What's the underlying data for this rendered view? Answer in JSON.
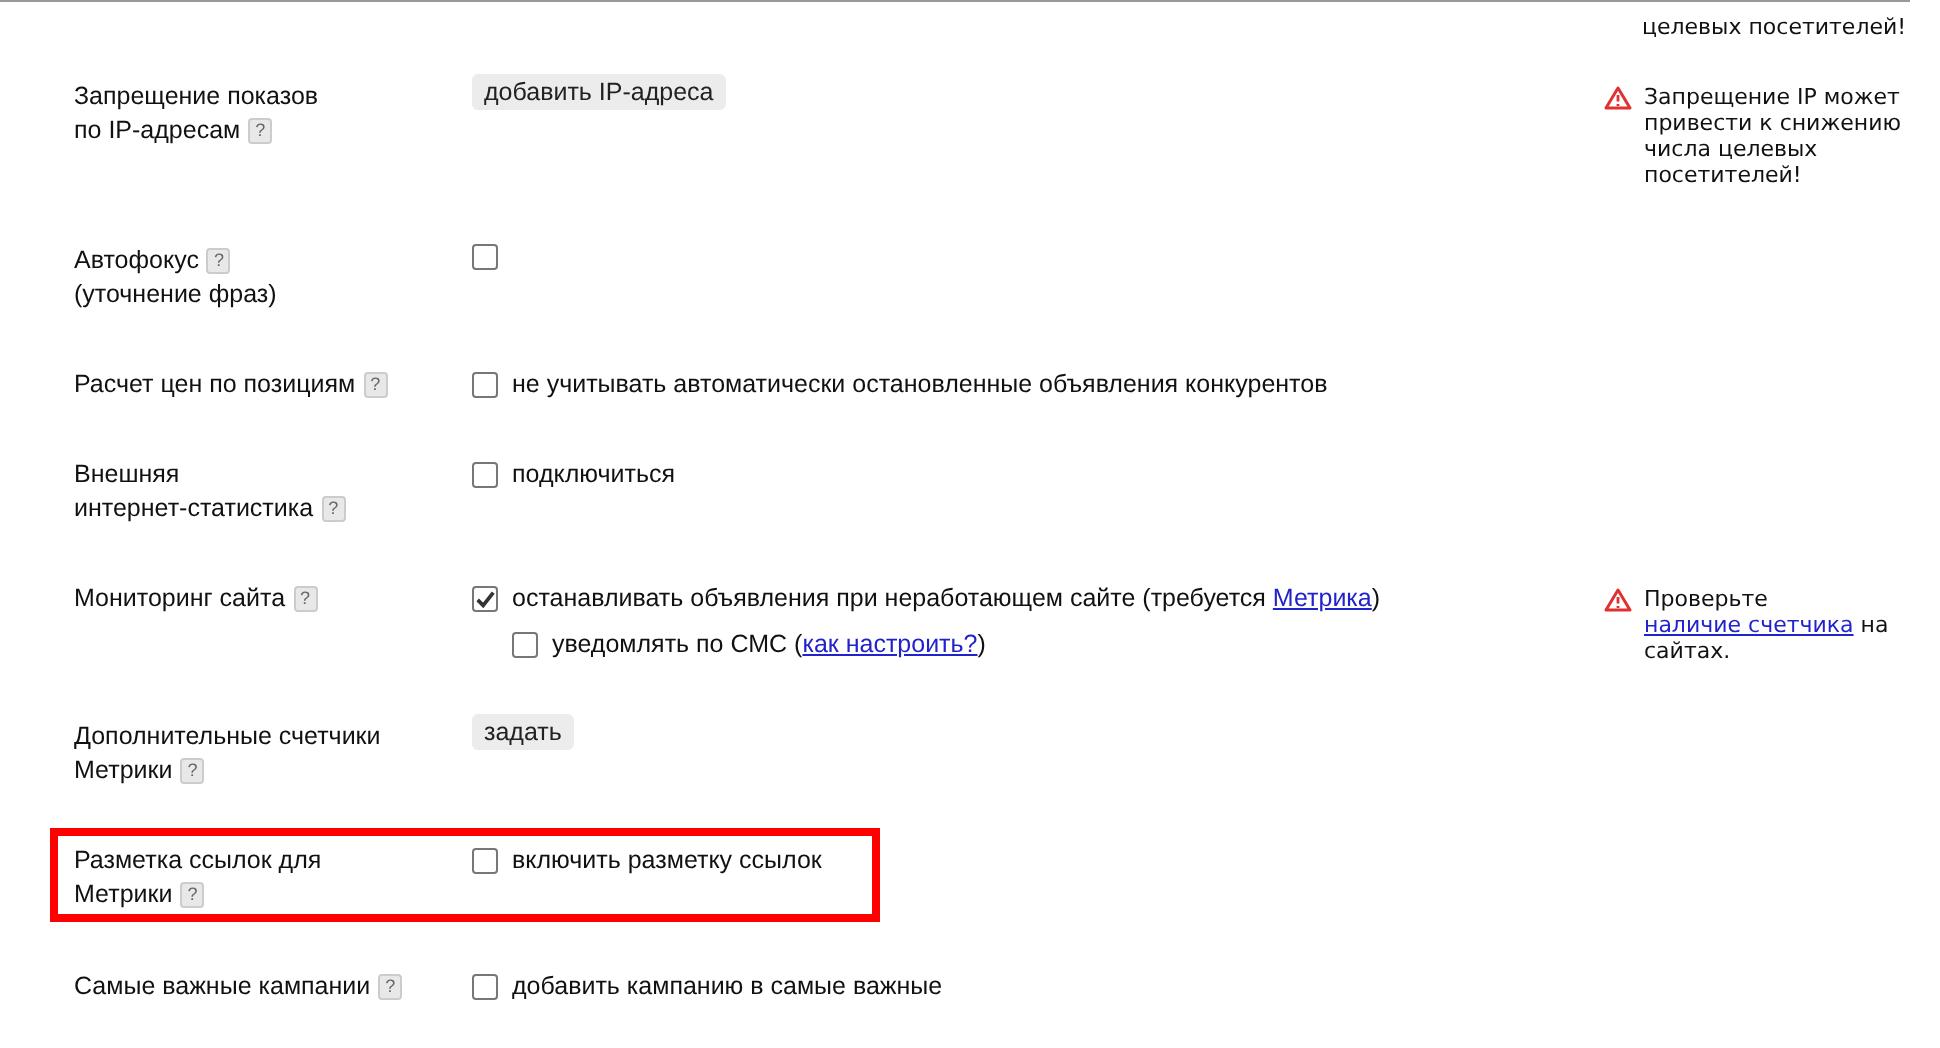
{
  "previous_note": {
    "parts": [
      {
        "text": "целевых посетителей!"
      }
    ]
  },
  "rows": [
    {
      "label_lines": [
        {
          "text": "Запрещение показов"
        },
        {
          "text": "по IP-адресам",
          "help": "?"
        }
      ],
      "highlighted": false,
      "controls": [
        {
          "kind": "button",
          "label": "добавить IP-адреса"
        }
      ],
      "note": {
        "parts": [
          {
            "text": "Запрещение IP может привести к снижению числа целевых посетителей!"
          }
        ]
      }
    },
    {
      "label_lines": [
        {
          "text": "Автофокус",
          "help": "?"
        },
        {
          "text": "(уточнение фраз)"
        }
      ],
      "highlighted": false,
      "controls": [
        {
          "kind": "checkbox",
          "checked": false
        }
      ]
    },
    {
      "label_lines": [
        {
          "text": "Расчет цен по позициям",
          "help": "?"
        }
      ],
      "highlighted": false,
      "controls": [
        {
          "kind": "checkbox",
          "checked": false,
          "parts": [
            {
              "text": "не учитывать автоматически остановленные объявления конкурентов"
            }
          ]
        }
      ]
    },
    {
      "label_lines": [
        {
          "text": "Внешняя"
        },
        {
          "text": "интернет-статистика",
          "help": "?"
        }
      ],
      "highlighted": false,
      "controls": [
        {
          "kind": "checkbox",
          "checked": false,
          "parts": [
            {
              "text": "подключиться"
            }
          ]
        }
      ]
    },
    {
      "label_lines": [
        {
          "text": "Мониторинг сайта",
          "help": "?"
        }
      ],
      "highlighted": false,
      "controls": [
        {
          "kind": "checkbox",
          "checked": true,
          "parts": [
            {
              "text": "останавливать объявления при неработающем сайте (требуется "
            },
            {
              "text": "Метрика",
              "link": true
            },
            {
              "text": ")"
            }
          ]
        },
        {
          "kind": "subcheckbox",
          "checked": false,
          "parts": [
            {
              "text": "уведомлять по СМС ("
            },
            {
              "text": "как настроить?",
              "link": true
            },
            {
              "text": ")"
            }
          ]
        }
      ],
      "note": {
        "parts": [
          {
            "text": "Проверьте "
          },
          {
            "text": "наличие счетчика",
            "link": true
          },
          {
            "text": " на сайтах."
          }
        ]
      }
    },
    {
      "label_lines": [
        {
          "text": "Дополнительные счетчики"
        },
        {
          "text": "Метрики",
          "help": "?"
        }
      ],
      "highlighted": false,
      "controls": [
        {
          "kind": "button",
          "label": "задать"
        }
      ]
    },
    {
      "label_lines": [
        {
          "text": "Разметка ссылок для"
        },
        {
          "text": "Метрики",
          "help": "?"
        }
      ],
      "highlighted": true,
      "controls": [
        {
          "kind": "checkbox",
          "checked": false,
          "parts": [
            {
              "text": "включить разметку ссылок"
            }
          ]
        }
      ]
    },
    {
      "label_lines": [
        {
          "text": "Самые важные кампании",
          "help": "?"
        }
      ],
      "highlighted": false,
      "controls": [
        {
          "kind": "checkbox",
          "checked": false,
          "parts": [
            {
              "text": "добавить кампанию в самые важные"
            }
          ]
        }
      ]
    }
  ]
}
